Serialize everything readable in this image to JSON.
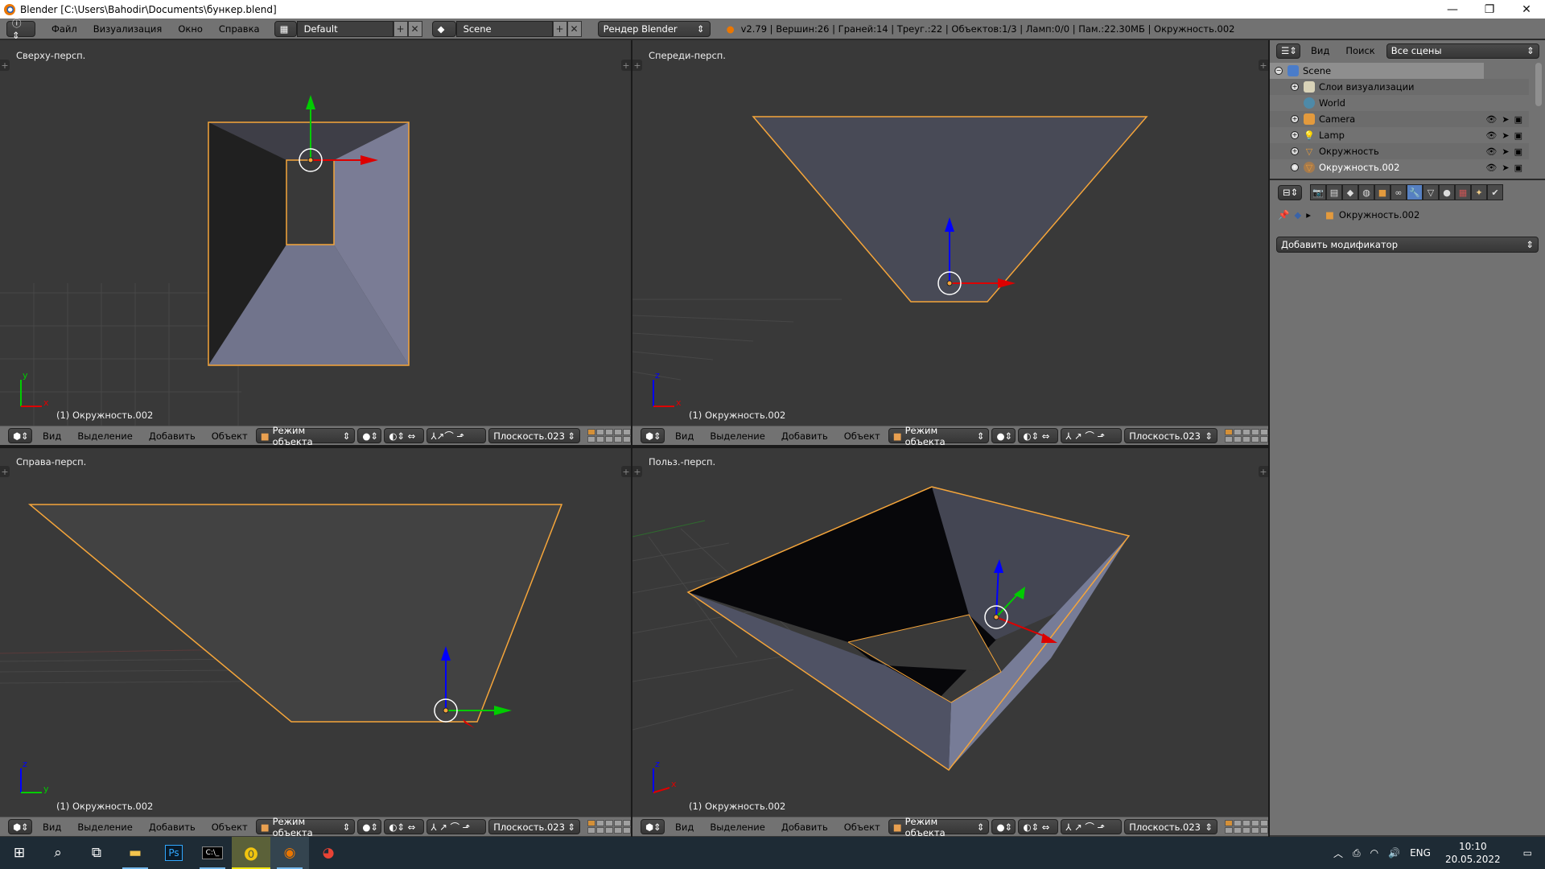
{
  "window": {
    "title": "Blender [C:\\Users\\Bahodir\\Documents\\бункер.blend]",
    "controls": {
      "minimize": "—",
      "restore": "❐",
      "close": "✕"
    }
  },
  "infobar": {
    "menus": [
      "Файл",
      "Визуализация",
      "Окно",
      "Справка"
    ],
    "layout": "Default",
    "scene": "Scene",
    "render_engine": "Рендер Blender",
    "stats": "v2.79 | Вершин:26 | Граней:14 | Треуг.:22 | Объектов:1/3 | Ламп:0/0 | Пам.:22.30МБ | Окружность.002"
  },
  "viewports": [
    {
      "label": "Сверху-персп.",
      "object": "(1) Окружность.002",
      "axes": [
        "y",
        "x"
      ]
    },
    {
      "label": "Спереди-персп.",
      "object": "(1) Окружность.002",
      "axes": [
        "z",
        "x"
      ]
    },
    {
      "label": "Справа-персп.",
      "object": "(1) Окружность.002",
      "axes": [
        "z",
        "y"
      ]
    },
    {
      "label": "Польз.-персп.",
      "object": "(1) Окружность.002",
      "axes": [
        "z",
        "x"
      ]
    }
  ],
  "view_header": {
    "menus": [
      "Вид",
      "Выделение",
      "Добавить",
      "Объект"
    ],
    "mode": "Режим объекта",
    "orientation": "Плоскость.023"
  },
  "outliner": {
    "menus": [
      "Вид",
      "Поиск"
    ],
    "filter": "Все сцены",
    "items": [
      {
        "label": "Scene",
        "icon": "scene-icon",
        "level": 0
      },
      {
        "label": "Слои визуализации",
        "icon": "render-layers-icon",
        "level": 1
      },
      {
        "label": "World",
        "icon": "world-icon",
        "level": 1
      },
      {
        "label": "Camera",
        "icon": "camera-icon",
        "level": 1
      },
      {
        "label": "Lamp",
        "icon": "lamp-icon",
        "level": 1
      },
      {
        "label": "Окружность",
        "icon": "mesh-icon",
        "level": 1
      },
      {
        "label": "Окружность.002",
        "icon": "mesh-icon",
        "level": 1
      }
    ]
  },
  "properties": {
    "context_object": "Окружность.002",
    "add_modifier": "Добавить модификатор"
  },
  "taskbar": {
    "apps": [
      "start",
      "search",
      "task-view",
      "file-explorer",
      "photoshop",
      "terminal",
      "app-a",
      "blender",
      "chrome"
    ],
    "tray": {
      "lang": "ENG",
      "time": "10:10",
      "date": "20.05.2022"
    }
  },
  "colors": {
    "selection": "#f5a53a",
    "accent": "#5680c2"
  }
}
